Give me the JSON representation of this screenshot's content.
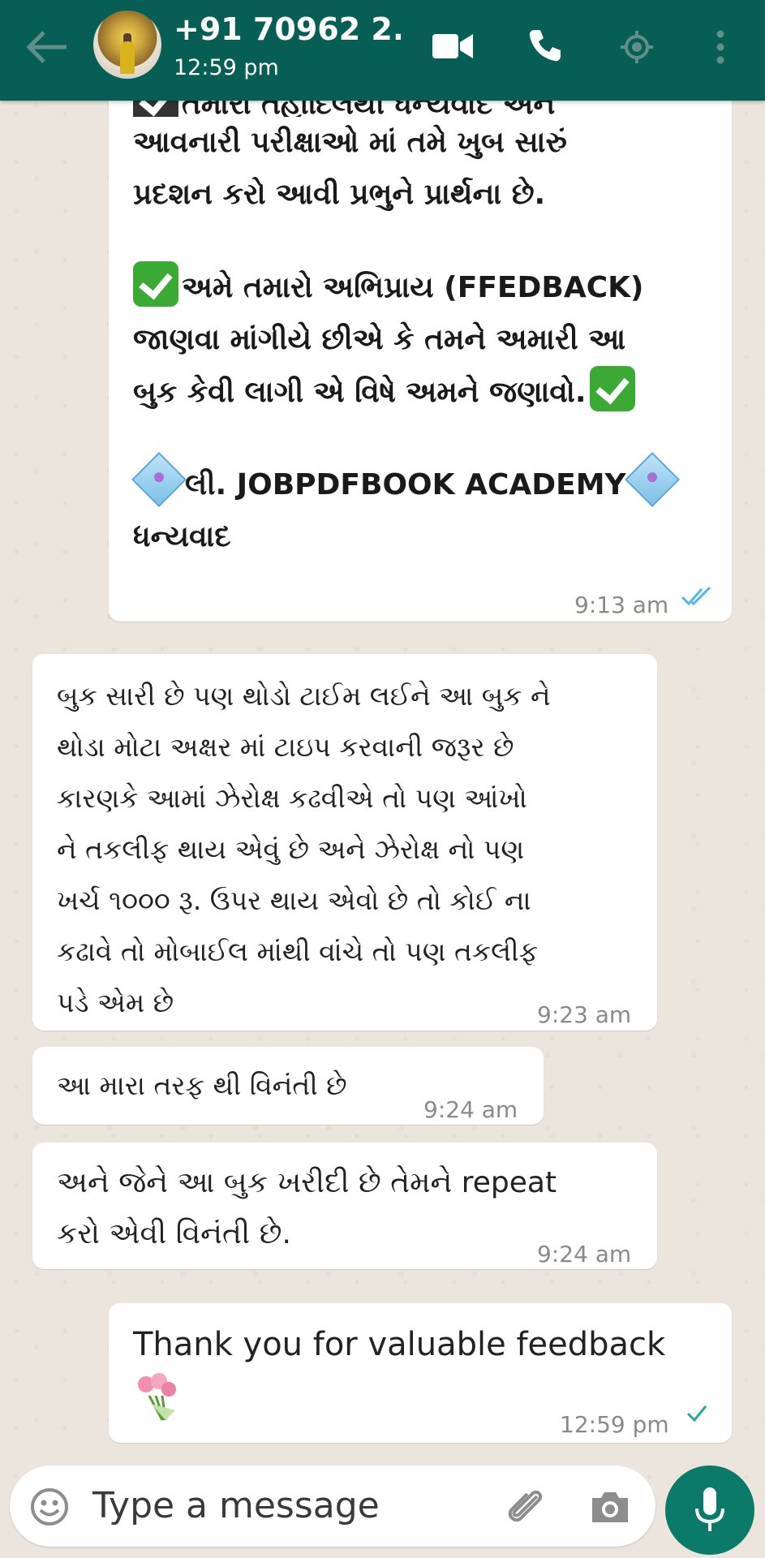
{
  "header": {
    "contact_name": "+91 70962 2...",
    "status": "12:59 pm",
    "icons": [
      "back-arrow-icon",
      "video-call-icon",
      "voice-call-icon",
      "location-icon",
      "more-options-icon"
    ]
  },
  "messages": [
    {
      "direction": "outgoing",
      "text_lines": [
        "તમારા તહોદિલથી ધન્યવાદ અને",
        "આવનારી પરીક્ષાઓ માં તમે ખુબ સારું",
        "પ્રદશન કરો આવી પ્રભુને પ્રાર્થના છે."
      ],
      "feedback_lines": [
        "અમે તમારો અભિપ્રાય (FFEDBACK)",
        "જાણવા માંગીયે છીએ કે તમને અમારી આ",
        "બુક કેવી લાગી એ વિષે અમને જણાવો."
      ],
      "sign_lines": [
        "લી. JOBPDFBOOK ACADEMY",
        "ધન્યવાદ"
      ],
      "time": "9:13 am",
      "ticks": "read"
    },
    {
      "direction": "incoming",
      "text": "બુક સારી છે પણ થોડો ટાઈમ લઈને આ બુક ને\nથોડા મોટા અક્ષર માં ટાઇપ કરવાની જરૂર છે\nકારણકે આમાં ઝેરોક્ષ કઢવીએ તો પણ આંખો\nને તકલીફ થાય એવું છે અને ઝેરોક્ષ નો પણ\nખર્ચ ૧૦૦૦ રૂ. ઉપર થાય એવો છે તો કોઈ ના\nકઢાવે તો મોબાઈલ માંથી વાંચે તો પણ તકલીફ\nપડે એમ છે",
      "time": "9:23 am"
    },
    {
      "direction": "incoming",
      "text": "આ મારા તરફ થી વિનંતી છે",
      "time": "9:24 am"
    },
    {
      "direction": "incoming",
      "text": "અને જેને આ બુક ખરીદી છે તેમને repeat\nકરો એવી વિનંતી છે.",
      "time": "9:24 am"
    },
    {
      "direction": "outgoing",
      "text": "Thank you for valuable feedback",
      "emoji": "bouquet",
      "time": "12:59 pm",
      "ticks": "sent"
    }
  ],
  "input": {
    "placeholder": "Type a message",
    "icons": [
      "emoji-icon",
      "attach-icon",
      "camera-icon",
      "mic-icon"
    ]
  },
  "colors": {
    "header": "#075e54",
    "outgoing_bubble": "#ffffff",
    "incoming_bubble": "#ffffff",
    "read_tick": "#4fb6ec",
    "mic_button": "#0b7a68"
  }
}
